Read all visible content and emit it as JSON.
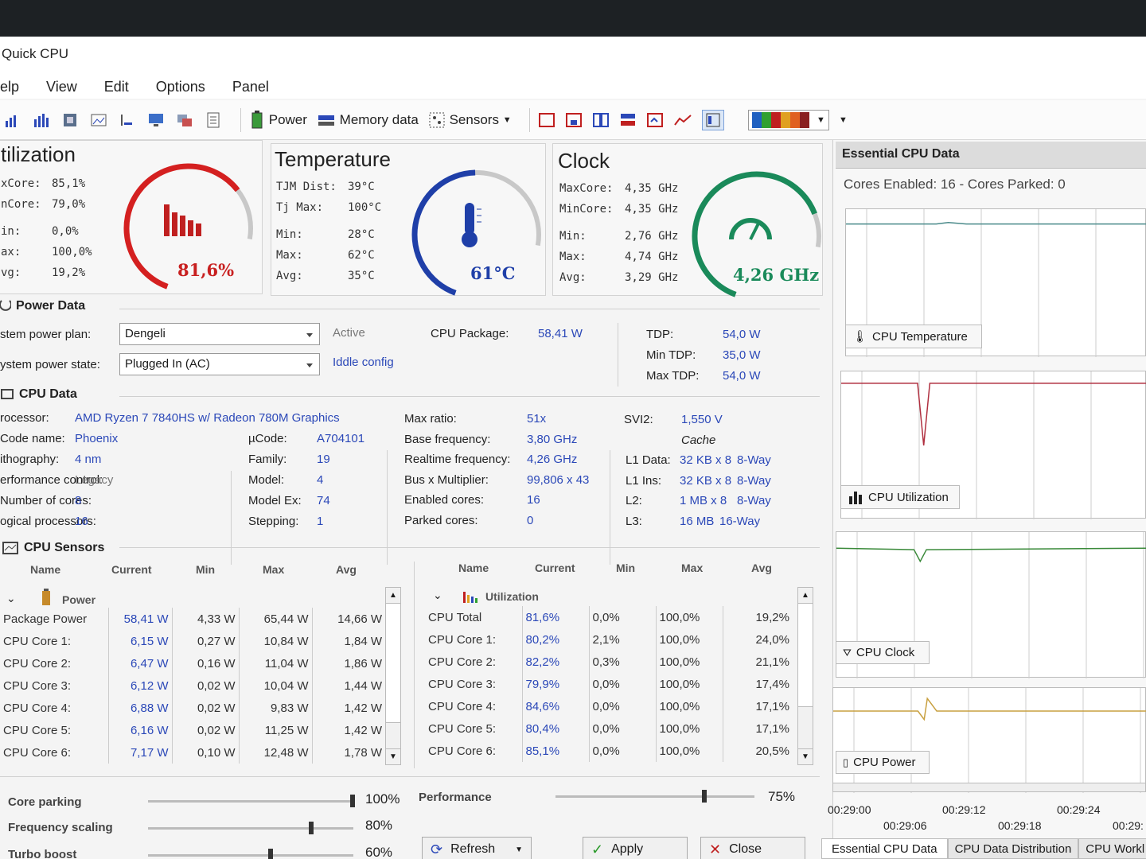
{
  "window": {
    "title": "Quick CPU"
  },
  "menu": [
    "elp",
    "View",
    "Edit",
    "Options",
    "Panel"
  ],
  "toolbar": {
    "power": "Power",
    "memory": "Memory data",
    "sensors": "Sensors"
  },
  "utilization": {
    "title": "tilization",
    "value": "81,6%",
    "rows": [
      {
        "k": "xCore:",
        "v": "85,1%"
      },
      {
        "k": "nCore:",
        "v": "79,0%"
      },
      {
        "k": "in:",
        "v": "0,0%"
      },
      {
        "k": "ax:",
        "v": "100,0%"
      },
      {
        "k": "vg:",
        "v": "19,2%"
      }
    ],
    "level": 0.816
  },
  "temperature": {
    "title": "Temperature",
    "value": "61°C",
    "rows": [
      {
        "k": "TJM Dist:",
        "v": "39°C"
      },
      {
        "k": "Tj Max:",
        "v": "100°C"
      },
      {
        "k": "Min:",
        "v": "28°C"
      },
      {
        "k": "Max:",
        "v": "62°C"
      },
      {
        "k": "Avg:",
        "v": "35°C"
      }
    ],
    "level": 0.61
  },
  "clock": {
    "title": "Clock",
    "value": "4,26 GHz",
    "rows": [
      {
        "k": "MaxCore:",
        "v": "4,35 GHz"
      },
      {
        "k": "MinCore:",
        "v": "4,35 GHz"
      },
      {
        "k": "Min:",
        "v": "2,76 GHz"
      },
      {
        "k": "Max:",
        "v": "4,74 GHz"
      },
      {
        "k": "Avg:",
        "v": "3,29 GHz"
      }
    ],
    "level": 0.88
  },
  "power_data": {
    "title": "Power Data",
    "plan_label": "stem power plan:",
    "plan_value": "Dengeli",
    "state_label": "ystem power state:",
    "state_value": "Plugged In (AC)",
    "active": "Active",
    "iddle": "Iddle config",
    "pkg_label": "CPU Package:",
    "pkg_value": "58,41 W",
    "tdp_label": "TDP:",
    "tdp_value": "54,0 W",
    "mintdp_label": "Min TDP:",
    "mintdp_value": "35,0 W",
    "maxtdp_label": "Max TDP:",
    "maxtdp_value": "54,0 W"
  },
  "cpu_data": {
    "title": "CPU Data",
    "processor_label": "rocessor:",
    "processor": "AMD Ryzen 7 7840HS w/ Radeon 780M Graphics",
    "col1": [
      {
        "k": "Code name:",
        "v": "Phoenix"
      },
      {
        "k": "ithography:",
        "v": "4 nm"
      },
      {
        "k": "erformance control:",
        "v": "Legacy"
      },
      {
        "k": "Number of cores:",
        "v": "8"
      },
      {
        "k": "ogical processors:",
        "v": "16"
      }
    ],
    "col2": [
      {
        "k": "µCode:",
        "v": "A704101"
      },
      {
        "k": "Family:",
        "v": "19"
      },
      {
        "k": "Model:",
        "v": "4"
      },
      {
        "k": "Model Ex:",
        "v": "74"
      },
      {
        "k": "Stepping:",
        "v": "1"
      }
    ],
    "col3": [
      {
        "k": "Max ratio:",
        "v": "51x"
      },
      {
        "k": "Base frequency:",
        "v": "3,80 GHz"
      },
      {
        "k": "Realtime frequency:",
        "v": "4,26 GHz"
      },
      {
        "k": "Bus x Multiplier:",
        "v": "99,806 x 43"
      },
      {
        "k": "Enabled cores:",
        "v": "16"
      },
      {
        "k": "Parked cores:",
        "v": "0"
      }
    ],
    "svi2_label": "SVI2:",
    "svi2": "1,550 V",
    "cache_label": "Cache",
    "cache": [
      {
        "k": "L1 Data:",
        "v": "32 KB x 8",
        "w": "8-Way"
      },
      {
        "k": "L1 Ins:",
        "v": "32 KB x 8",
        "w": "8-Way"
      },
      {
        "k": "L2:",
        "v": "1 MB x 8",
        "w": "8-Way"
      },
      {
        "k": "L3:",
        "v": "16 MB",
        "w": "16-Way"
      }
    ]
  },
  "sensors": {
    "title": "CPU Sensors",
    "headers": [
      "Name",
      "Current",
      "Min",
      "Max",
      "Avg"
    ],
    "power_group": "Power",
    "power_rows": [
      [
        "Package Power",
        "58,41 W",
        "4,33 W",
        "65,44 W",
        "14,66 W"
      ],
      [
        "CPU Core 1:",
        "6,15 W",
        "0,27 W",
        "10,84 W",
        "1,84 W"
      ],
      [
        "CPU Core 2:",
        "6,47 W",
        "0,16 W",
        "11,04 W",
        "1,86 W"
      ],
      [
        "CPU Core 3:",
        "6,12 W",
        "0,02 W",
        "10,04 W",
        "1,44 W"
      ],
      [
        "CPU Core 4:",
        "6,88 W",
        "0,02 W",
        "9,83 W",
        "1,42 W"
      ],
      [
        "CPU Core 5:",
        "6,16 W",
        "0,02 W",
        "11,25 W",
        "1,42 W"
      ],
      [
        "CPU Core 6:",
        "7,17 W",
        "0,10 W",
        "12,48 W",
        "1,78 W"
      ]
    ],
    "util_group": "Utilization",
    "util_rows": [
      [
        "CPU Total",
        "81,6%",
        "0,0%",
        "100,0%",
        "19,2%"
      ],
      [
        "CPU Core 1:",
        "80,2%",
        "2,1%",
        "100,0%",
        "24,0%"
      ],
      [
        "CPU Core 2:",
        "82,2%",
        "0,3%",
        "100,0%",
        "21,1%"
      ],
      [
        "CPU Core 3:",
        "79,9%",
        "0,0%",
        "100,0%",
        "17,4%"
      ],
      [
        "CPU Core 4:",
        "84,6%",
        "0,0%",
        "100,0%",
        "17,1%"
      ],
      [
        "CPU Core 5:",
        "80,4%",
        "0,0%",
        "100,0%",
        "17,1%"
      ],
      [
        "CPU Core 6:",
        "85,1%",
        "0,0%",
        "100,0%",
        "20,5%"
      ]
    ]
  },
  "controls": {
    "core_parking": "Core parking",
    "core_parking_val": "100%",
    "core_parking_level": 1.0,
    "freq_scaling": "Frequency scaling",
    "freq_scaling_val": "80%",
    "freq_scaling_level": 0.8,
    "turbo": "Turbo boost",
    "turbo_val": "60%",
    "turbo_level": 0.6,
    "performance": "Performance",
    "performance_val": "75%",
    "performance_level": 0.75,
    "refresh": "Refresh",
    "apply": "Apply",
    "close": "Close"
  },
  "essential": {
    "title": "Essential CPU Data",
    "cores_info": "Cores Enabled: 16 - Cores Parked: 0",
    "charts": [
      "CPU Temperature",
      "CPU Utilization",
      "CPU Clock",
      "CPU Power"
    ],
    "times_top": [
      "00:29:00",
      "00:29:12",
      "00:29:24"
    ],
    "times_bottom": [
      "00:29:06",
      "00:29:18",
      "00:29:"
    ],
    "tabs": [
      "Essential CPU Data",
      "CPU Data Distribution",
      "CPU Workl"
    ]
  },
  "colors": {
    "util": "#d42020",
    "temp": "#1f3fa8",
    "clock": "#1a8a5a",
    "value_blue": "#2b48b8"
  }
}
